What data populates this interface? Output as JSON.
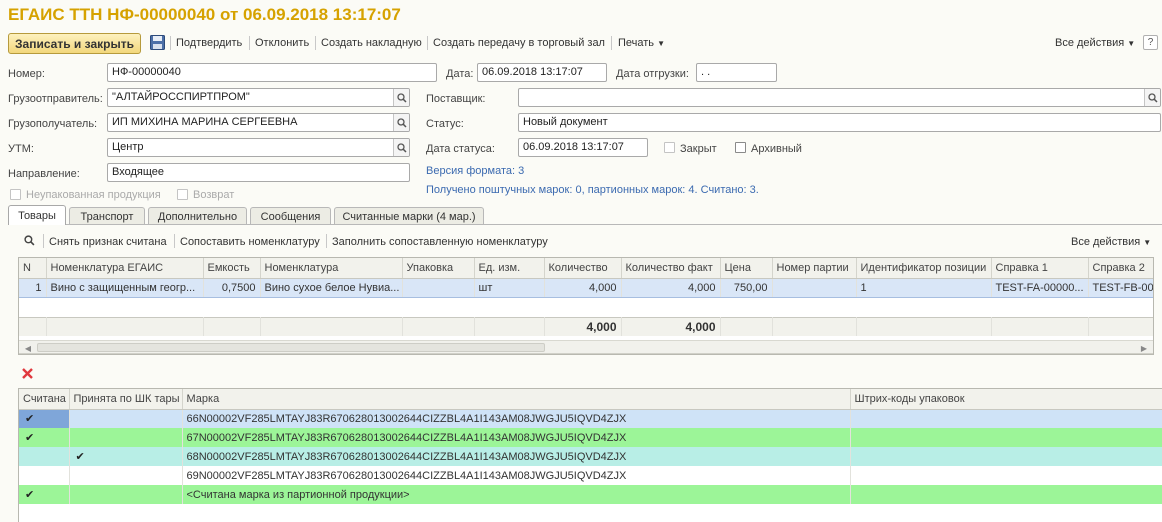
{
  "window": {
    "title": "ЕГАИС ТТН НФ-00000040 от 06.09.2018 13:17:07"
  },
  "toolbar": {
    "save_close": "Записать и закрыть",
    "items": [
      "Подтвердить",
      "Отклонить",
      "Создать накладную",
      "Создать передачу в торговый зал",
      "Печать"
    ],
    "all_actions": "Все действия",
    "help": "?"
  },
  "form": {
    "number_label": "Номер:",
    "number_value": "НФ-00000040",
    "date_label": "Дата:",
    "date_value": "06.09.2018 13:17:07",
    "ship_date_label": "Дата отгрузки:",
    "ship_date_value": " .  .",
    "shipper_label": "Грузоотправитель:",
    "shipper_value": "\"АЛТАЙРОССПИРТПРОМ\"",
    "supplier_label": "Поставщик:",
    "supplier_value": "",
    "consignee_label": "Грузополучатель:",
    "consignee_value": "ИП МИХИНА МАРИНА СЕРГЕЕВНА",
    "status_label": "Статус:",
    "status_value": "Новый документ",
    "utm_label": "УТМ:",
    "utm_value": "Центр",
    "status_date_label": "Дата статуса:",
    "status_date_value": "06.09.2018 13:17:07",
    "closed_label": "Закрыт",
    "archive_label": "Архивный",
    "direction_label": "Направление:",
    "direction_value": "Входящее",
    "format_version": "Версия формата: 3",
    "marks_info": "Получено поштучных марок: 0, партионных марок: 4. Считано: 3.",
    "unpacked_label": "Неупакованная продукция",
    "return_label": "Возврат"
  },
  "tabs": [
    "Товары",
    "Транспорт",
    "Дополнительно",
    "Сообщения",
    "Считанные марки (4 мар.)"
  ],
  "goods_toolbar": {
    "remove_read": "Снять признак считана",
    "match": "Сопоставить номенклатуру",
    "fill_matched": "Заполнить сопоставленную номенклатуру",
    "all_actions": "Все действия"
  },
  "goods_table": {
    "columns": [
      "N",
      "Номенклатура ЕГАИС",
      "Емкость",
      "Номенклатура",
      "Упаковка",
      "Ед. изм.",
      "Количество",
      "Количество факт",
      "Цена",
      "Номер партии",
      "Идентификатор позиции",
      "Справка 1",
      "Справка 2"
    ],
    "rows": [
      [
        "1",
        "Вино с защищенным геогр...",
        "0,7500",
        "Вино сухое белое Нувиа...",
        "",
        "шт",
        "4,000",
        "4,000",
        "750,00",
        "",
        "1",
        "TEST-FA-00000...",
        "TEST-FB-00"
      ]
    ],
    "totals": {
      "quantity": "4,000",
      "quantity_fact": "4,000"
    }
  },
  "marks_table": {
    "columns": [
      "Считана",
      "Принята по ШК тары",
      "Марка",
      "Штрих-коды упаковок"
    ],
    "rows": [
      {
        "read": "✔",
        "accepted": "",
        "mark": "66N00002VF285LMTAYJ83R670628013002644CIZZBL4A1I143AM08JWGJU5IQVD4ZJX",
        "barcodes": "",
        "style": "row-blue"
      },
      {
        "read": "✔",
        "accepted": "",
        "mark": "67N00002VF285LMTAYJ83R670628013002644CIZZBL4A1I143AM08JWGJU5IQVD4ZJX",
        "barcodes": "",
        "style": "row-green"
      },
      {
        "read": "",
        "accepted": "✔",
        "mark": "68N00002VF285LMTAYJ83R670628013002644CIZZBL4A1I143AM08JWGJU5IQVD4ZJX",
        "barcodes": "",
        "style": "row-cyan"
      },
      {
        "read": "",
        "accepted": "",
        "mark": "69N00002VF285LMTAYJ83R670628013002644CIZZBL4A1I143AM08JWGJU5IQVD4ZJX",
        "barcodes": "",
        "style": "row-white"
      },
      {
        "read": "✔",
        "accepted": "",
        "mark": "<Считана марка из партионной продукции>",
        "barcodes": "",
        "style": "row-green"
      }
    ]
  },
  "colors": {
    "title": "#d6a200",
    "link": "#3b6ab0",
    "green_row": "#9cf598",
    "cyan_row": "#b8eee6",
    "blue_row": "#cfe3f7"
  },
  "icons": {
    "save": "floppy-icon",
    "search": "search-icon",
    "delete": "delete-x-icon"
  }
}
